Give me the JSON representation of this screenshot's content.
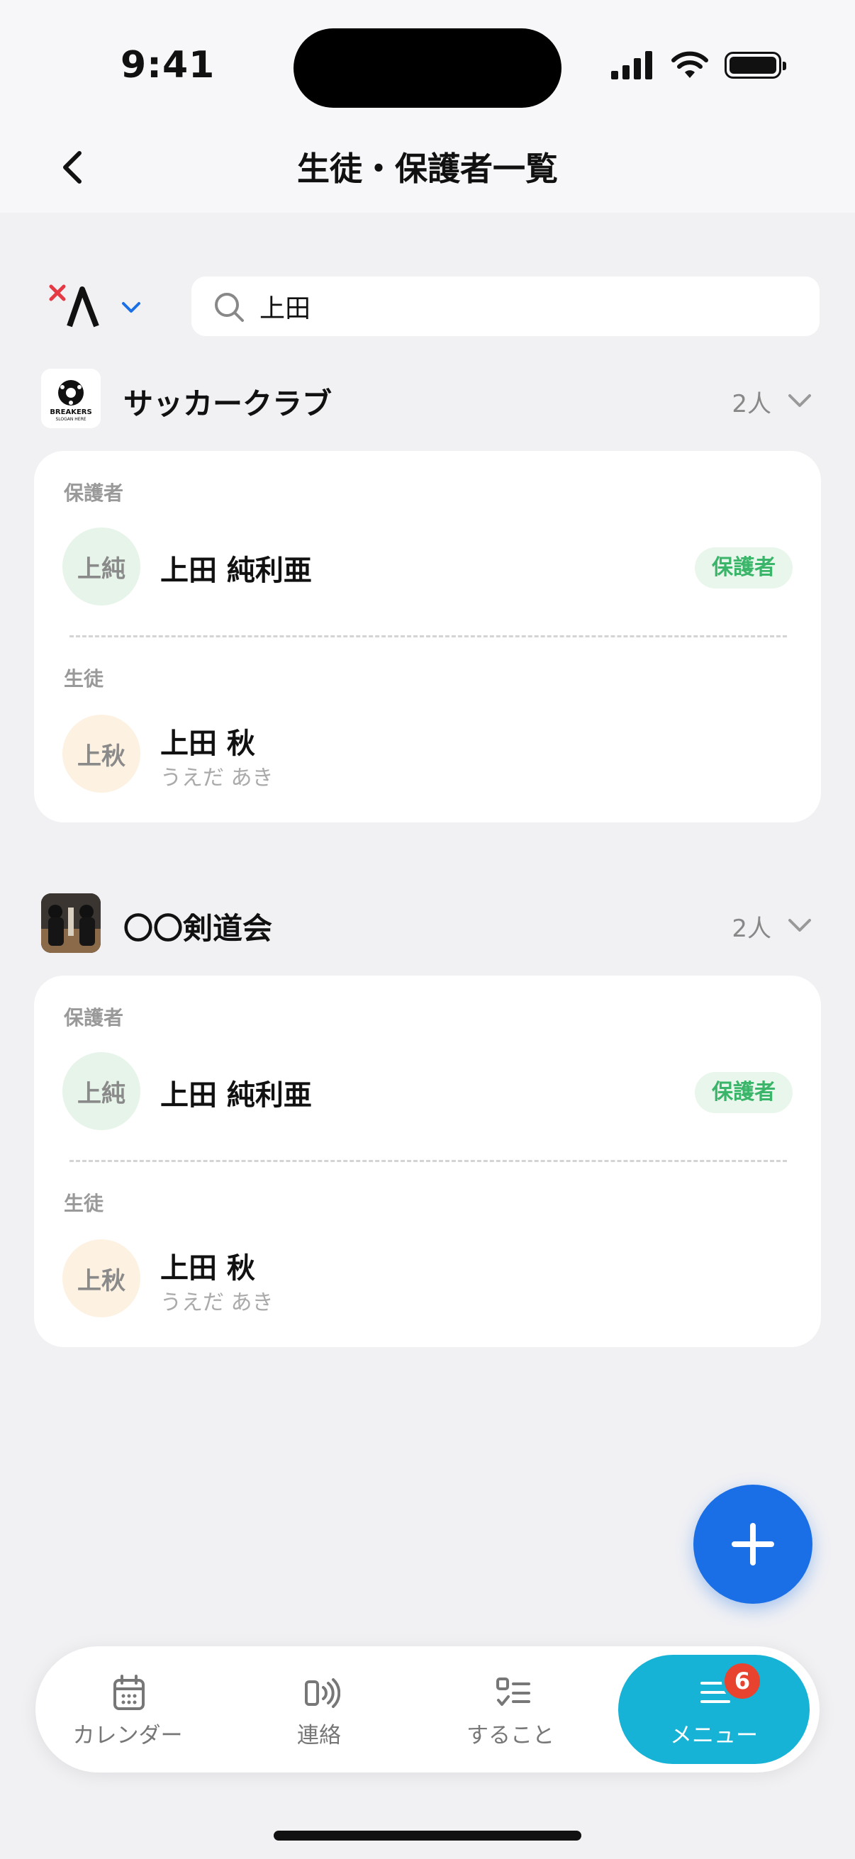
{
  "status_bar": {
    "time": "9:41"
  },
  "header": {
    "title": "生徒・保護者一覧"
  },
  "search": {
    "value": "上田"
  },
  "groups": [
    {
      "name": "サッカークラブ",
      "count": "2人",
      "logo_text": "BREAKERS",
      "logo_subtext": "SLOGAN HERE",
      "guardian_label": "保護者",
      "guardian": {
        "avatar": "上純",
        "name": "上田 純利亜",
        "badge": "保護者"
      },
      "student_label": "生徒",
      "student": {
        "avatar": "上秋",
        "name": "上田 秋",
        "kana": "うえだ あき"
      }
    },
    {
      "name": "〇〇剣道会",
      "count": "2人",
      "guardian_label": "保護者",
      "guardian": {
        "avatar": "上純",
        "name": "上田 純利亜",
        "badge": "保護者"
      },
      "student_label": "生徒",
      "student": {
        "avatar": "上秋",
        "name": "上田 秋",
        "kana": "うえだ あき"
      }
    }
  ],
  "tabs": [
    {
      "label": "カレンダー",
      "icon": "calendar-icon"
    },
    {
      "label": "連絡",
      "icon": "broadcast-icon"
    },
    {
      "label": "すること",
      "icon": "checklist-icon"
    },
    {
      "label": "メニュー",
      "icon": "menu-icon",
      "badge": "6",
      "active": true
    }
  ],
  "colors": {
    "accent": "#1a6fe6",
    "active_tab": "#16b3d6",
    "badge_red": "#e8432f",
    "guardian_badge": "#3bb56a"
  }
}
